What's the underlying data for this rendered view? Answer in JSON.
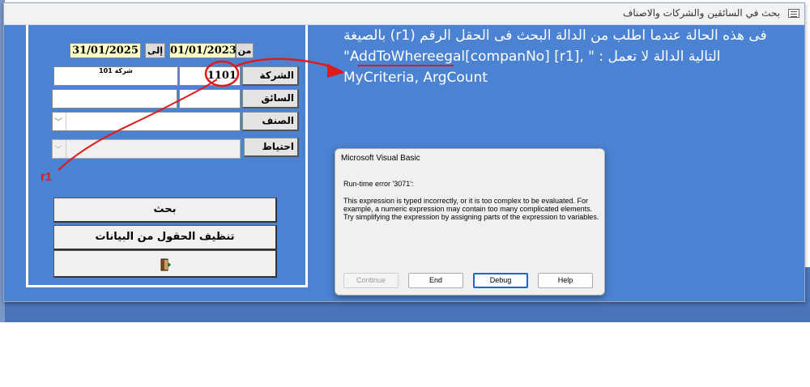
{
  "window": {
    "title": "بحث في السائقين والشركات والاصناف",
    "close_glyph": "✕"
  },
  "form": {
    "from_label": "من",
    "from_date": "01/01/2023",
    "to_label": "إلى",
    "to_date": "31/01/2025",
    "company_label": "الشركة",
    "company_code": "1101",
    "company_name": "شركة 101",
    "driver_label": "السائق",
    "category_label": "الصنف",
    "reserve_label": "احتياط",
    "search_button": "بحث",
    "clear_button": "تنظيف الحقول من البيانات",
    "exit_icon": "exit-door-icon"
  },
  "annotation": {
    "r1_label": "r1",
    "line1": "فى هذه الحالة عندما اطلب من الدالة البحث فى الحقل الرقم (r1) بالصيغة",
    "line2": "التالية الدالة لا تعمل :  \" ,[r1] AddToWhereegal[companNo]\"",
    "line3": "MyCriteria,  ArgCount"
  },
  "dialog": {
    "title": "Microsoft Visual Basic",
    "error": "Run-time error '3071':",
    "message": "This expression is typed incorrectly, or it is too complex to be evaluated.  For example, a numeric expression may contain too many complicated elements.  Try simplifying the expression by assigning parts of the expression to variables.",
    "buttons": [
      "Continue",
      "End",
      "Debug",
      "Help"
    ]
  },
  "colors": {
    "form_background": "#4c82d2",
    "date_field": "#ffffc8",
    "annotation_red": "#e01a1a",
    "default_button_border": "#0a6ad8"
  }
}
